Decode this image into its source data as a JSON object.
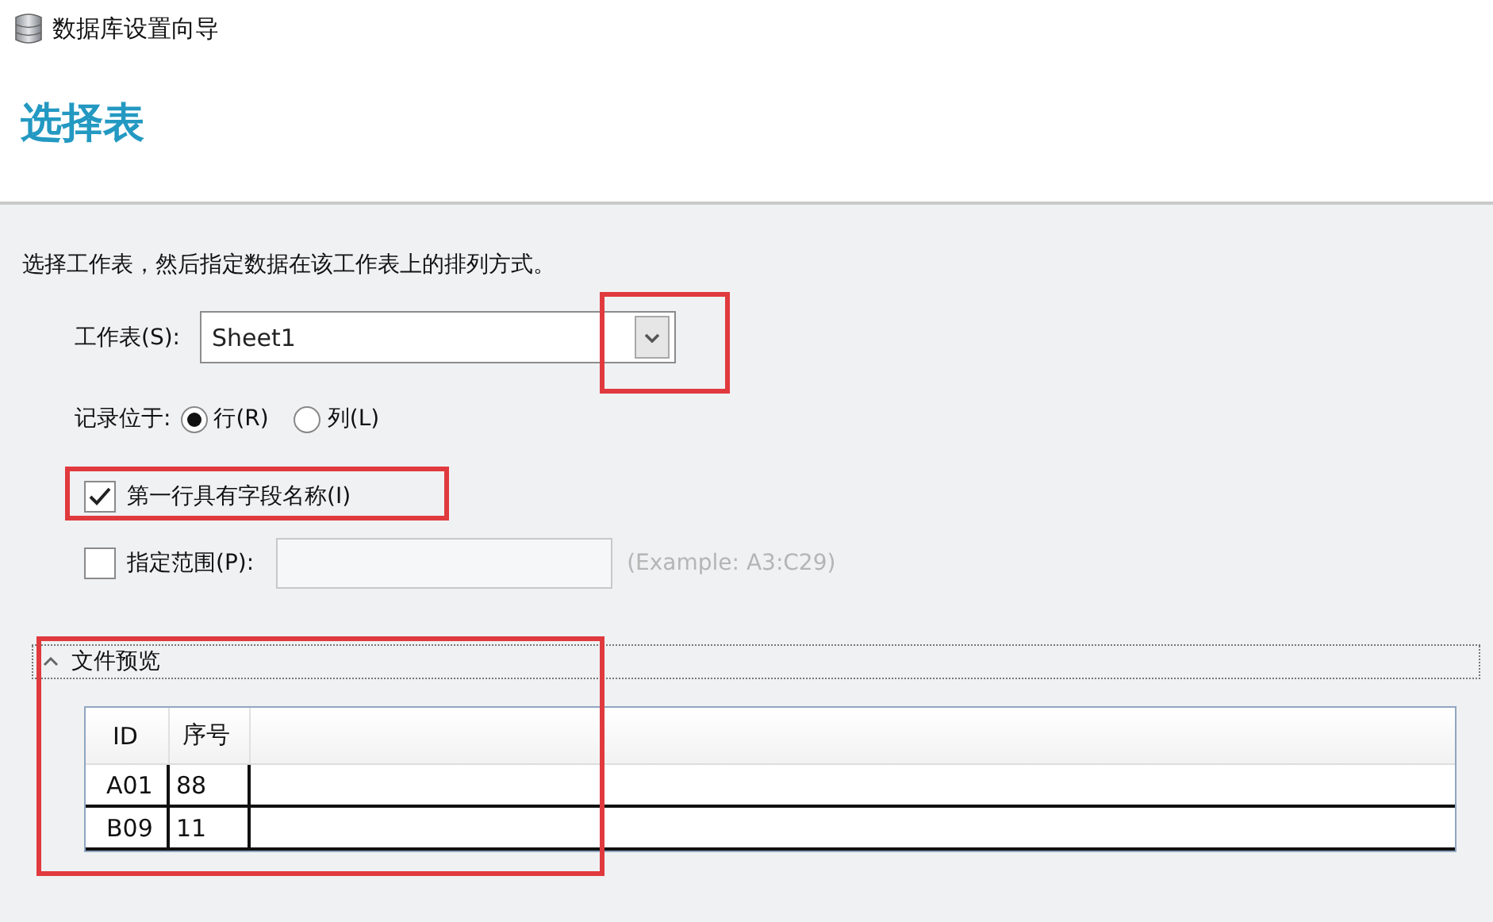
{
  "window": {
    "title": "数据库设置向导"
  },
  "heading": "选择表",
  "instruction": "选择工作表，然后指定数据在该工作表上的排列方式。",
  "worksheet": {
    "label": "工作表(S):",
    "value": "Sheet1",
    "highlighted": true
  },
  "records": {
    "label": "记录位于:",
    "options": [
      {
        "label": "行(R)",
        "selected": true
      },
      {
        "label": "列(L)",
        "selected": false
      }
    ]
  },
  "first_row_names": {
    "label": "第一行具有字段名称(I)",
    "checked": true,
    "highlighted": true
  },
  "range": {
    "label": "指定范围(P):",
    "checked": false,
    "hint": "(Example: A3:C29)"
  },
  "preview": {
    "title": "文件预览",
    "expanded": true,
    "highlighted": true,
    "columns": [
      "ID",
      "序号"
    ],
    "rows": [
      [
        "A01",
        "88"
      ],
      [
        "B09",
        "11"
      ]
    ]
  }
}
